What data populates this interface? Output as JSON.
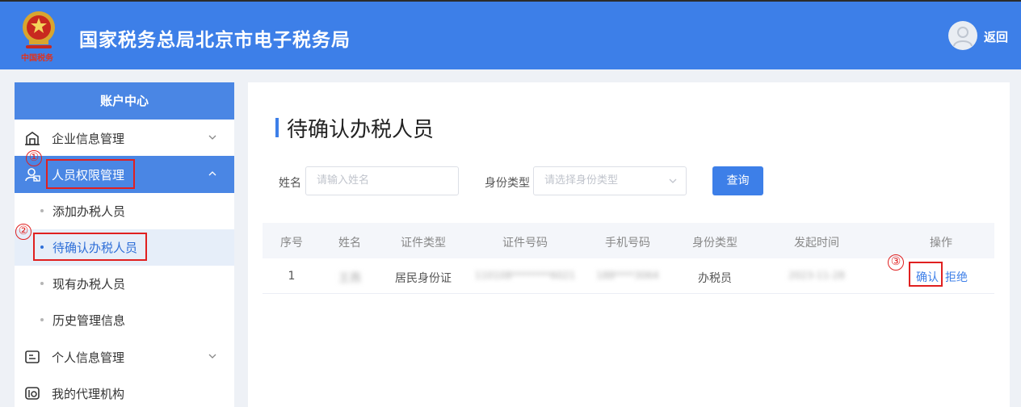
{
  "header": {
    "title": "国家税务总局北京市电子税务局",
    "logo_text": "中国税务",
    "back_label": "返回"
  },
  "sidebar": {
    "title": "账户中心",
    "items": [
      {
        "label": "企业信息管理",
        "icon": "building-icon"
      },
      {
        "label": "人员权限管理",
        "icon": "user-lock-icon"
      },
      {
        "label": "添加办税人员"
      },
      {
        "label": "待确认办税人员"
      },
      {
        "label": "现有办税人员"
      },
      {
        "label": "历史管理信息"
      },
      {
        "label": "个人信息管理",
        "icon": "id-card-icon"
      },
      {
        "label": "我的代理机构",
        "icon": "agency-icon"
      }
    ]
  },
  "annotations": [
    "①",
    "②",
    "③"
  ],
  "main": {
    "title": "待确认办税人员",
    "filters": {
      "name_label": "姓名",
      "name_placeholder": "请输入姓名",
      "type_label": "身份类型",
      "type_placeholder": "请选择身份类型",
      "query_label": "查询"
    },
    "table": {
      "headers": [
        "序号",
        "姓名",
        "证件类型",
        "证件号码",
        "手机号码",
        "身份类型",
        "发起时间",
        "操作"
      ],
      "rows": [
        {
          "index": "1",
          "name": "王燕",
          "id_type": "居民身份证",
          "id_number": "110108********6021",
          "phone": "188****3064",
          "role": "办税员",
          "time": "2023-11-28",
          "confirm": "确认",
          "reject": "拒绝"
        }
      ]
    }
  },
  "colors": {
    "brand": "#3d7fe8",
    "annotation": "#e02020"
  }
}
